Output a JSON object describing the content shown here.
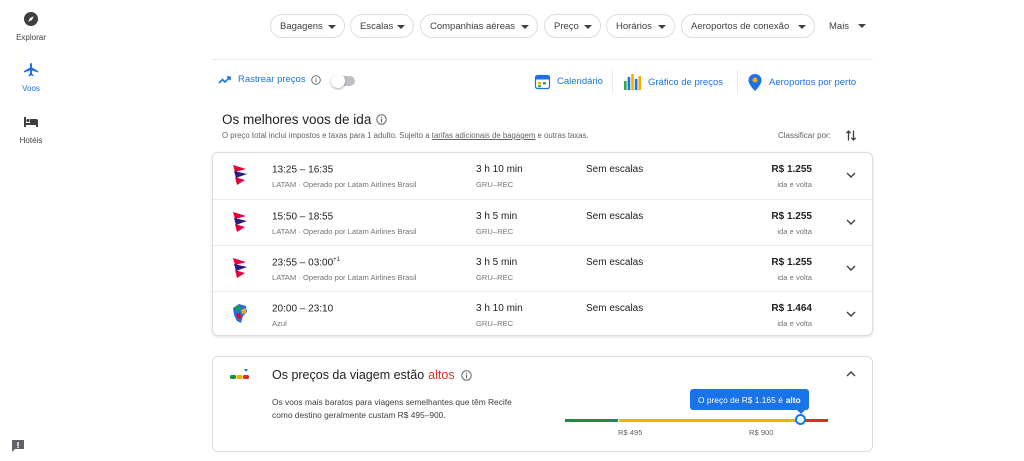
{
  "sidebar": {
    "items": [
      {
        "label": "Explorar",
        "icon": "compass-icon"
      },
      {
        "label": "Voos",
        "icon": "airplane-icon"
      },
      {
        "label": "Hotéis",
        "icon": "bed-icon"
      }
    ]
  },
  "filters": {
    "chips": [
      "Bagagens",
      "Escalas",
      "Companhias aéreas",
      "Preço",
      "Horários",
      "Aeroportos de conexão"
    ],
    "more": "Mais"
  },
  "tools": {
    "track_label": "Rastrear preços",
    "calendar": "Calendário",
    "price_graph": "Gráfico de preços",
    "nearby_airports": "Aeroportos por perto"
  },
  "results": {
    "title": "Os melhores voos de ida",
    "note_prefix": "O preço total inclui impostos e taxas para 1 adulto. Sujeito a ",
    "note_link": "tarifas adicionais de bagagem",
    "note_suffix": " e outras taxas.",
    "sort_label": "Classificar por:",
    "flights": [
      {
        "times": "13:25 – 16:35",
        "plus": "",
        "airline": "LATAM · Operado por Latam Airlines Brasil",
        "duration": "3 h 10 min",
        "route": "GRU–REC",
        "stops": "Sem escalas",
        "price": "R$ 1.255",
        "trip": "ida e volta",
        "logo": "latam-logo"
      },
      {
        "times": "15:50 – 18:55",
        "plus": "",
        "airline": "LATAM · Operado por Latam Airlines Brasil",
        "duration": "3 h 5 min",
        "route": "GRU–REC",
        "stops": "Sem escalas",
        "price": "R$ 1.255",
        "trip": "ida e volta",
        "logo": "latam-logo"
      },
      {
        "times": "23:55 – 03:00",
        "plus": "+1",
        "airline": "LATAM · Operado por Latam Airlines Brasil",
        "duration": "3 h 5 min",
        "route": "GRU–REC",
        "stops": "Sem escalas",
        "price": "R$ 1.255",
        "trip": "ida e volta",
        "logo": "latam-logo"
      },
      {
        "times": "20:00 – 23:10",
        "plus": "",
        "airline": "Azul",
        "duration": "3 h 10 min",
        "route": "GRU–REC",
        "stops": "Sem escalas",
        "price": "R$ 1.464",
        "trip": "ida e volta",
        "logo": "azul-logo"
      }
    ]
  },
  "insight": {
    "title_prefix": "Os preços da viagem estão",
    "title_level": "altos",
    "description": "Os voos mais baratos para viagens semelhantes que têm Recife como destino geralmente custam R$ 495–900.",
    "tooltip_prefix": "O preço de R$ 1.165 é",
    "tooltip_level": "alto",
    "low_tick": "R$ 495",
    "high_tick": "R$ 900",
    "current_price": 1165,
    "typical_range": [
      495,
      900
    ],
    "colors": {
      "low": "#1e8e3e",
      "typical": "#f9ab00",
      "high": "#d93025"
    }
  },
  "colors": {
    "accent": "#1a73e8",
    "high": "#d93025"
  }
}
